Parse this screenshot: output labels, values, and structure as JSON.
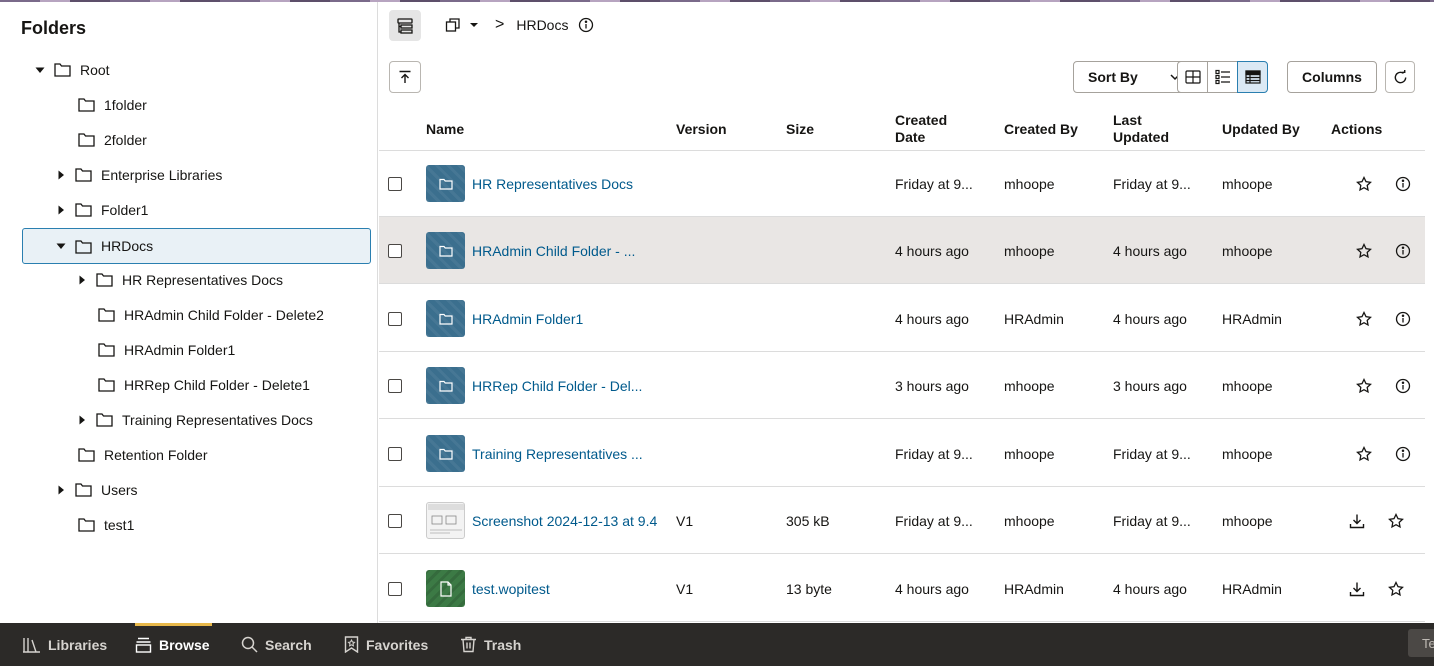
{
  "left_panel": {
    "title": "Folders",
    "tree": [
      {
        "label": "Root",
        "caret": "down"
      },
      {
        "label": "1folder",
        "caret": "none"
      },
      {
        "label": "2folder",
        "caret": "none"
      },
      {
        "label": "Enterprise Libraries",
        "caret": "right"
      },
      {
        "label": "Folder1",
        "caret": "right"
      },
      {
        "label": "HRDocs",
        "caret": "down",
        "selected": true
      },
      {
        "label": "HR Representatives Docs",
        "caret": "right"
      },
      {
        "label": "HRAdmin Child Folder - Delete2",
        "caret": "none"
      },
      {
        "label": "HRAdmin Folder1",
        "caret": "none"
      },
      {
        "label": "HRRep Child Folder - Delete1",
        "caret": "none"
      },
      {
        "label": "Training Representatives Docs",
        "caret": "right"
      },
      {
        "label": "Retention Folder",
        "caret": "none"
      },
      {
        "label": "Users",
        "caret": "right"
      },
      {
        "label": "test1",
        "caret": "none"
      }
    ]
  },
  "toolbar": {
    "breadcrumb_separator": ">",
    "current_folder": "HRDocs",
    "sort_by_label": "Sort By",
    "columns_label": "Columns"
  },
  "table": {
    "headers": {
      "name": "Name",
      "version": "Version",
      "size": "Size",
      "created_date_1": "Created",
      "created_date_2": "Date",
      "created_by": "Created By",
      "last_updated_1": "Last",
      "last_updated_2": "Updated",
      "updated_by": "Updated By",
      "actions": "Actions"
    },
    "rows": [
      {
        "kind": "folder",
        "name": "HR Representatives Docs",
        "version": "",
        "size": "",
        "created": "Friday at 9...",
        "created_by": "mhoope",
        "updated": "Friday at 9...",
        "updated_by": "mhoope"
      },
      {
        "kind": "folder",
        "name": "HRAdmin Child Folder - ...",
        "version": "",
        "size": "",
        "created": "4 hours ago",
        "created_by": "mhoope",
        "updated": "4 hours ago",
        "updated_by": "mhoope",
        "hover": true
      },
      {
        "kind": "folder",
        "name": "HRAdmin Folder1",
        "version": "",
        "size": "",
        "created": "4 hours ago",
        "created_by": "HRAdmin",
        "updated": "4 hours ago",
        "updated_by": "HRAdmin"
      },
      {
        "kind": "folder",
        "name": "HRRep Child Folder - Del...",
        "version": "",
        "size": "",
        "created": "3 hours ago",
        "created_by": "mhoope",
        "updated": "3 hours ago",
        "updated_by": "mhoope"
      },
      {
        "kind": "folder",
        "name": "Training Representatives ...",
        "version": "",
        "size": "",
        "created": "Friday at 9...",
        "created_by": "mhoope",
        "updated": "Friday at 9...",
        "updated_by": "mhoope"
      },
      {
        "kind": "shot",
        "name": "Screenshot 2024-12-13 at 9.4",
        "version": "V1",
        "size": "305 kB",
        "created": "Friday at 9...",
        "created_by": "mhoope",
        "updated": "Friday at 9...",
        "updated_by": "mhoope"
      },
      {
        "kind": "file",
        "name": "test.wopitest",
        "version": "V1",
        "size": "13 byte",
        "created": "4 hours ago",
        "created_by": "HRAdmin",
        "updated": "4 hours ago",
        "updated_by": "HRAdmin"
      }
    ]
  },
  "bottom_nav": {
    "items": [
      {
        "label": "Libraries",
        "icon": "library-icon"
      },
      {
        "label": "Browse",
        "icon": "browse-icon",
        "active": true
      },
      {
        "label": "Search",
        "icon": "search-icon"
      },
      {
        "label": "Favorites",
        "icon": "favorites-icon"
      },
      {
        "label": "Trash",
        "icon": "trash-icon"
      }
    ],
    "corner_tab": "Te"
  },
  "colors": {
    "link": "#005a8c",
    "folder_thumb": "#3b6f8e",
    "file_thumb": "#3c7a45",
    "bottom_bar": "#2c2a28",
    "active_accent": "#e8b84a",
    "selection_border": "#2a7fb0"
  }
}
